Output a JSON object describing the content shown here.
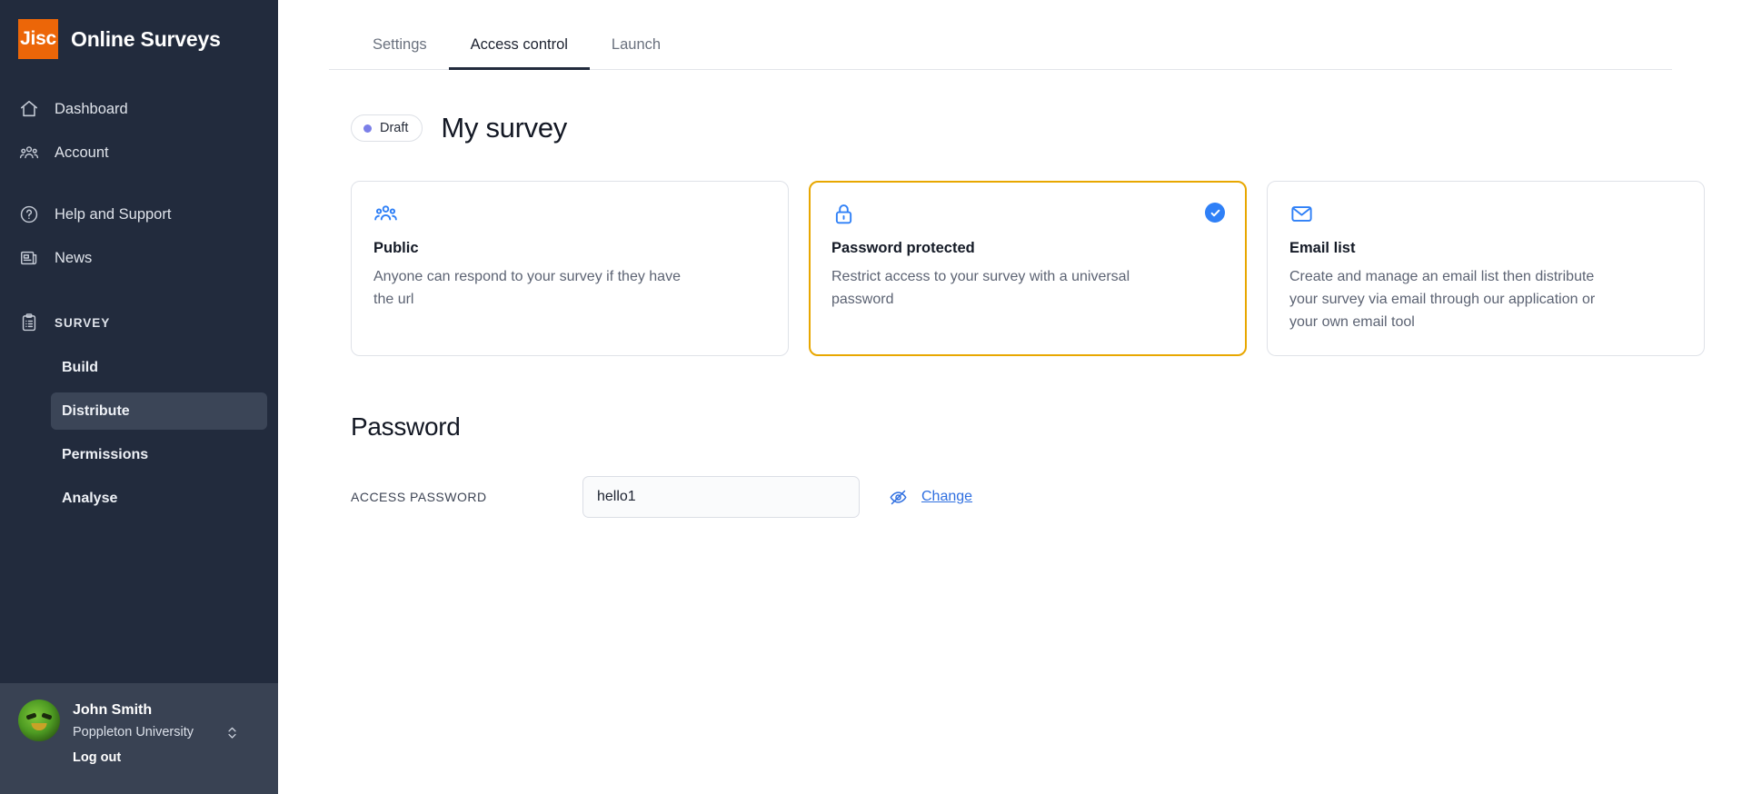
{
  "brand": {
    "logo_text": "Jisc",
    "product_name": "Online Surveys",
    "logo_color": "#ec6608"
  },
  "sidebar": {
    "nav_items": [
      {
        "label": "Dashboard",
        "icon": "home-icon"
      },
      {
        "label": "Account",
        "icon": "people-icon"
      },
      {
        "label": "Help and Support",
        "icon": "question-circle-icon"
      },
      {
        "label": "News",
        "icon": "newspaper-icon"
      }
    ],
    "section": {
      "label": "SURVEY",
      "icon": "clipboard-list-icon"
    },
    "sub_items": [
      {
        "label": "Build",
        "active": false
      },
      {
        "label": "Distribute",
        "active": true
      },
      {
        "label": "Permissions",
        "active": false
      },
      {
        "label": "Analyse",
        "active": false
      }
    ],
    "user": {
      "name": "John Smith",
      "organisation": "Poppleton University",
      "logout_label": "Log out"
    },
    "background_color": "#222b3d",
    "active_item_color": "#3b4557"
  },
  "tabs": [
    {
      "label": "Settings",
      "active": false
    },
    {
      "label": "Access control",
      "active": true
    },
    {
      "label": "Launch",
      "active": false
    }
  ],
  "page": {
    "status_badge": "Draft",
    "status_dot_color": "#7b7fe8",
    "title": "My survey"
  },
  "access_options": [
    {
      "icon": "people-group-icon",
      "title": "Public",
      "description": "Anyone can respond to your survey if they have the url",
      "selected": false
    },
    {
      "icon": "lock-icon",
      "title": "Password protected",
      "description": "Restrict access to your survey with a universal password",
      "selected": true
    },
    {
      "icon": "envelope-icon",
      "title": "Email list",
      "description": "Create and manage an email list then distribute your survey via email through our application or your own email tool",
      "selected": false
    }
  ],
  "password_section": {
    "heading": "Password",
    "field_label": "ACCESS PASSWORD",
    "value": "hello1",
    "placeholder": "",
    "change_label": "Change",
    "selected_border_color": "#e8a700",
    "accent_color": "#2f80f7"
  }
}
